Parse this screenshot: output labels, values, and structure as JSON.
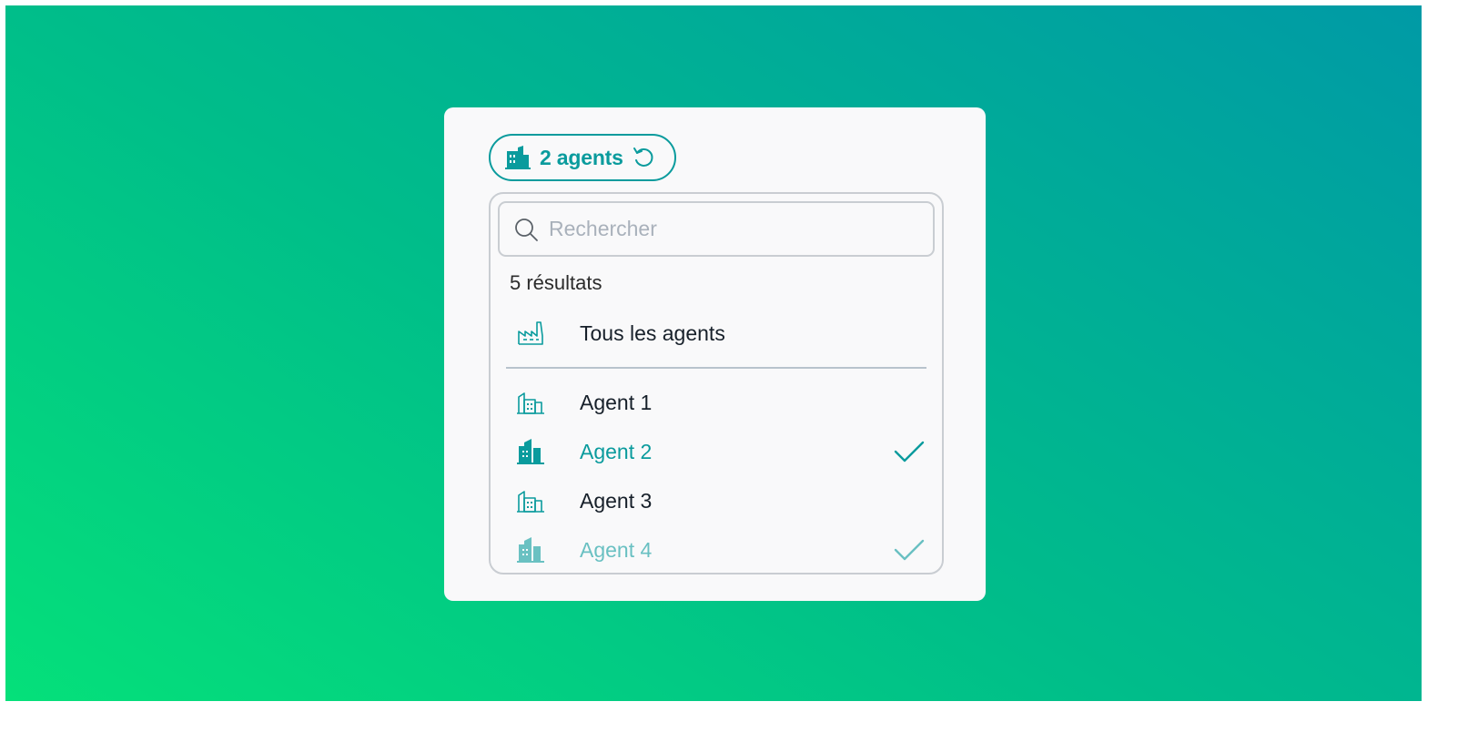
{
  "filter_chip": {
    "label": "2 agents",
    "icon": "building-filled-icon",
    "reset_icon": "reset-icon"
  },
  "search": {
    "placeholder": "Rechercher",
    "value": ""
  },
  "results_count": "5 résultats",
  "all_option": {
    "label": "Tous les agents",
    "icon": "factory-icon"
  },
  "agents": [
    {
      "label": "Agent 1",
      "selected": false
    },
    {
      "label": "Agent 2",
      "selected": true
    },
    {
      "label": "Agent 3",
      "selected": false
    },
    {
      "label": "Agent 4",
      "selected": true
    }
  ],
  "colors": {
    "accent": "#0a9b9d",
    "border": "#c9cdd2",
    "text": "#17202a",
    "placeholder": "#a9b1bb"
  }
}
